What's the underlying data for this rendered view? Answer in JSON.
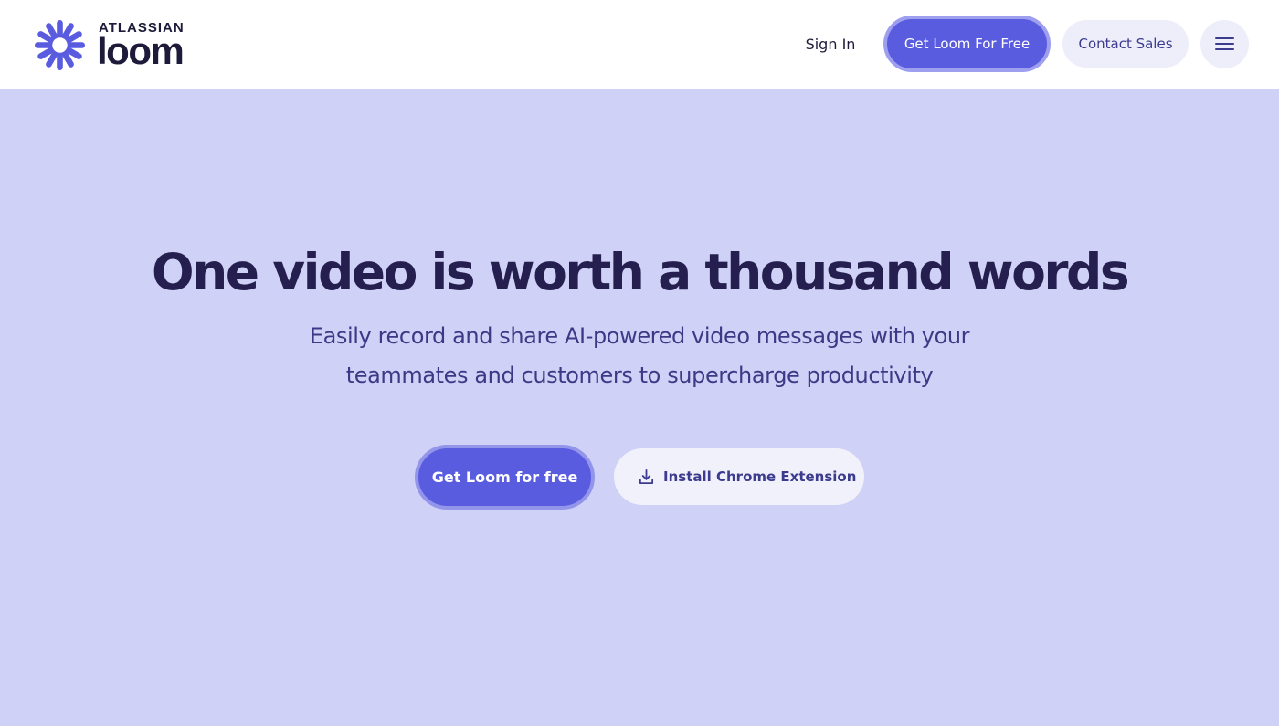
{
  "header": {
    "logo": {
      "brand": "ATLASSIAN",
      "product": "loom",
      "icon": "loom-burst-icon"
    },
    "nav": {
      "sign_in": "Sign In",
      "get_free": "Get Loom For Free",
      "contact_sales": "Contact Sales",
      "menu_icon": "hamburger-menu-icon"
    }
  },
  "hero": {
    "title": "One video is worth a thousand words",
    "subtitle_line1": "Easily record and share AI-powered video messages with your",
    "subtitle_line2": "teammates and customers to supercharge productivity",
    "primary_cta": "Get Loom for free",
    "secondary_cta": "Install Chrome Extension",
    "secondary_icon": "download-icon"
  },
  "colors": {
    "accent": "#5a5ce0",
    "hero_bg": "#d0d1f6",
    "heading": "#251f4f",
    "secondary_button_bg": "#f1f1fc"
  }
}
